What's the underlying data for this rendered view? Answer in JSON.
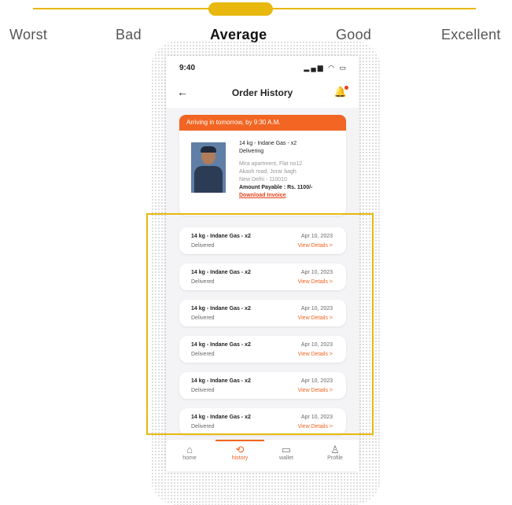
{
  "rating_scale": {
    "labels": [
      "Worst",
      "Bad",
      "Average",
      "Good",
      "Excellent"
    ],
    "selected": "Average"
  },
  "phone": {
    "status_time": "9:40",
    "status_icons": "▂▄▆ ◠ ▭",
    "title": "Order History",
    "back_icon": "←",
    "bell_icon": "🔔",
    "active_order": {
      "banner": "Arriving in tomorrow, by 9:30 A.M.",
      "product": "14 kg - Indane Gas - x2",
      "status": "Delivering",
      "address_line1": "Mira apartment, Flat no12",
      "address_line2": "Akash road, Jorar bagh",
      "address_line3": "New Delhi - 110010",
      "amount": "Amount Payable : Rs. 1100/-",
      "invoice": "Download Invoice"
    },
    "orders": [
      {
        "name": "14 kg - Indane Gas - x2",
        "status": "Delivered",
        "date": "Apr 10, 2023",
        "action": "View Details >"
      },
      {
        "name": "14 kg - Indane Gas - x2",
        "status": "Delivered",
        "date": "Apr 10, 2023",
        "action": "View Details >"
      },
      {
        "name": "14 kg - Indane Gas - x2",
        "status": "Delivered",
        "date": "Apr 10, 2023",
        "action": "View Details >"
      },
      {
        "name": "14 kg - Indane Gas - x2",
        "status": "Delivered",
        "date": "Apr 10, 2023",
        "action": "View Details >"
      },
      {
        "name": "14 kg - Indane Gas - x2",
        "status": "Delivered",
        "date": "Apr 10, 2023",
        "action": "View Details >"
      },
      {
        "name": "14 kg - Indane Gas - x2",
        "status": "Delivered",
        "date": "Apr 10, 2023",
        "action": "View Details >"
      }
    ],
    "tabs": [
      {
        "label": "home",
        "icon": "⌂"
      },
      {
        "label": "history",
        "icon": "⟲"
      },
      {
        "label": "wallet",
        "icon": "▭"
      },
      {
        "label": "Profile",
        "icon": "♙"
      }
    ],
    "active_tab": "history"
  },
  "colors": {
    "accent": "#f26522",
    "scale_highlight": "#e8b80e"
  }
}
